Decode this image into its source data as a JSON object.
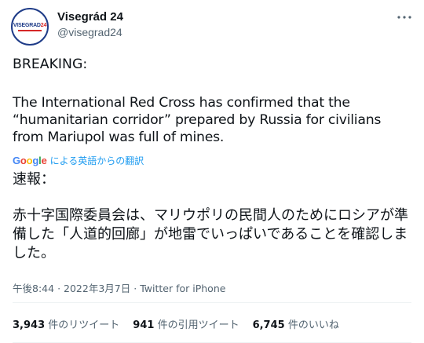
{
  "account": {
    "display_name": "Visegrád 24",
    "handle": "@visegrad24",
    "avatar_text_main": "VISEGRAD",
    "avatar_text_num": "24"
  },
  "tweet": {
    "breaking": "BREAKING:",
    "english": "The International Red Cross has confirmed that the\n“humanitarian corridor” prepared by Russia for civilians\nfrom Mariupol was full of mines.",
    "translate_label": "による英語からの翻訳",
    "japanese_title": "速報：",
    "japanese_body": "赤十字国際委員会は、マリウポリの民間人のためにロシアが準備した「人道的回廊」が地雷でいっぱいであることを確認しました。"
  },
  "meta": {
    "time": "午後8:44",
    "date": "2022年3月7日",
    "separator": "·",
    "source": "Twitter for iPhone"
  },
  "stats": [
    {
      "count": "3,943",
      "label": "件のリツイート"
    },
    {
      "count": "941",
      "label": "件の引用ツイート"
    },
    {
      "count": "6,745",
      "label": "件のいいね"
    }
  ],
  "icons": {
    "more": "more-horizontal-icon",
    "google": "google-logo"
  },
  "colors": {
    "text": "#0f1419",
    "muted": "#536471",
    "link": "#1d9bf0",
    "brand_blue": "#1f3c88",
    "brand_red": "#d62828"
  }
}
